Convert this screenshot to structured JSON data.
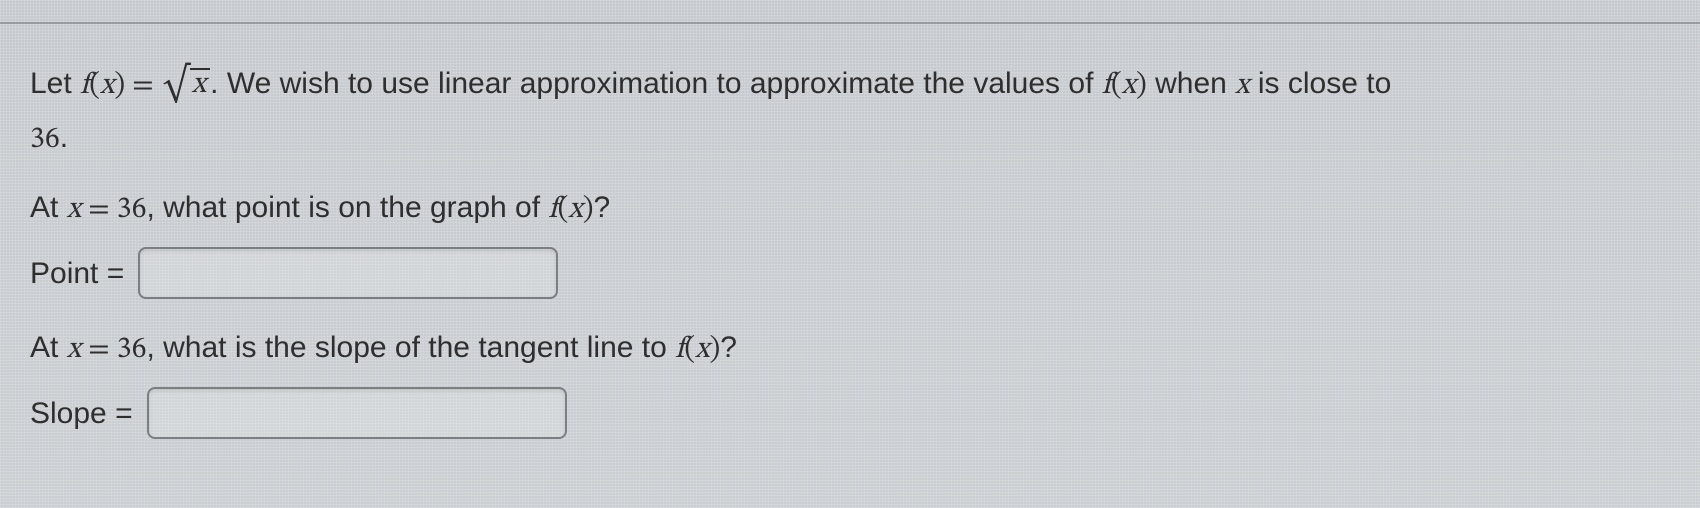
{
  "problem": {
    "intro_prefix": "Let ",
    "fx_markup": "f(x) = √x",
    "intro_mid": ". We wish to use linear approximation to approximate the values of ",
    "fx2_markup": "f(x)",
    "intro_suffix": " when ",
    "x_var": "x",
    "intro_end": " is close to",
    "a_value": "36",
    "period": "."
  },
  "q1": {
    "prefix": "At ",
    "x_eq": "x = 36",
    "mid": ", what point is on the graph of ",
    "fx": "f(x)",
    "q": "?",
    "label": "Point =",
    "value": ""
  },
  "q2": {
    "prefix": "At ",
    "x_eq": "x = 36",
    "mid": ", what is the slope of the tangent line to ",
    "fx": "f(x)",
    "q": "?",
    "label": "Slope =",
    "value": ""
  }
}
